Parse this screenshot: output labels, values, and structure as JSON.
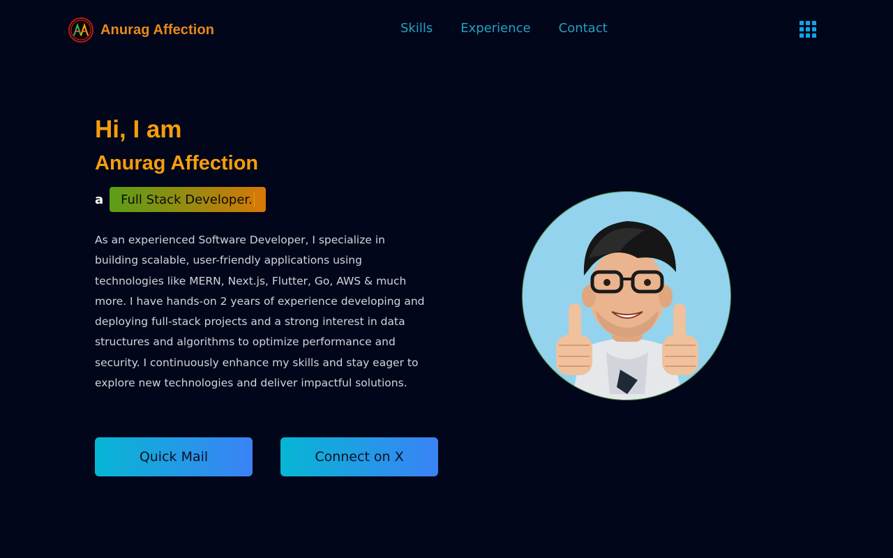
{
  "header": {
    "brand_name": "Anurag Affection",
    "logo_icon": "aa-logo-icon",
    "nav": [
      {
        "label": "Skills"
      },
      {
        "label": "Experience"
      },
      {
        "label": "Contact"
      }
    ],
    "menu_icon": "grid-menu-icon"
  },
  "hero": {
    "greeting": "Hi, I am",
    "name": "Anurag Affection",
    "role_prefix": "a",
    "role": "Full Stack Developer.",
    "bio": "As an experienced Software Developer, I specialize in building scalable, user-friendly applications using technologies like MERN, Next.js, Flutter, Go, AWS & much more. I have hands-on 2 years of experience developing and deploying full-stack projects and a strong interest in data structures and algorithms to optimize performance and security. I continuously enhance my skills and stay eager to explore new technologies and deliver impactful solutions.",
    "buttons": {
      "quick_mail": "Quick Mail",
      "connect_x": "Connect on X"
    }
  },
  "colors": {
    "background": "#02061a",
    "accent_orange": "#f59e0b",
    "nav_link": "#1fa3c4",
    "button_gradient_start": "#06b6d4",
    "button_gradient_end": "#3b82f6",
    "avatar_bg": "#93d3ee"
  }
}
